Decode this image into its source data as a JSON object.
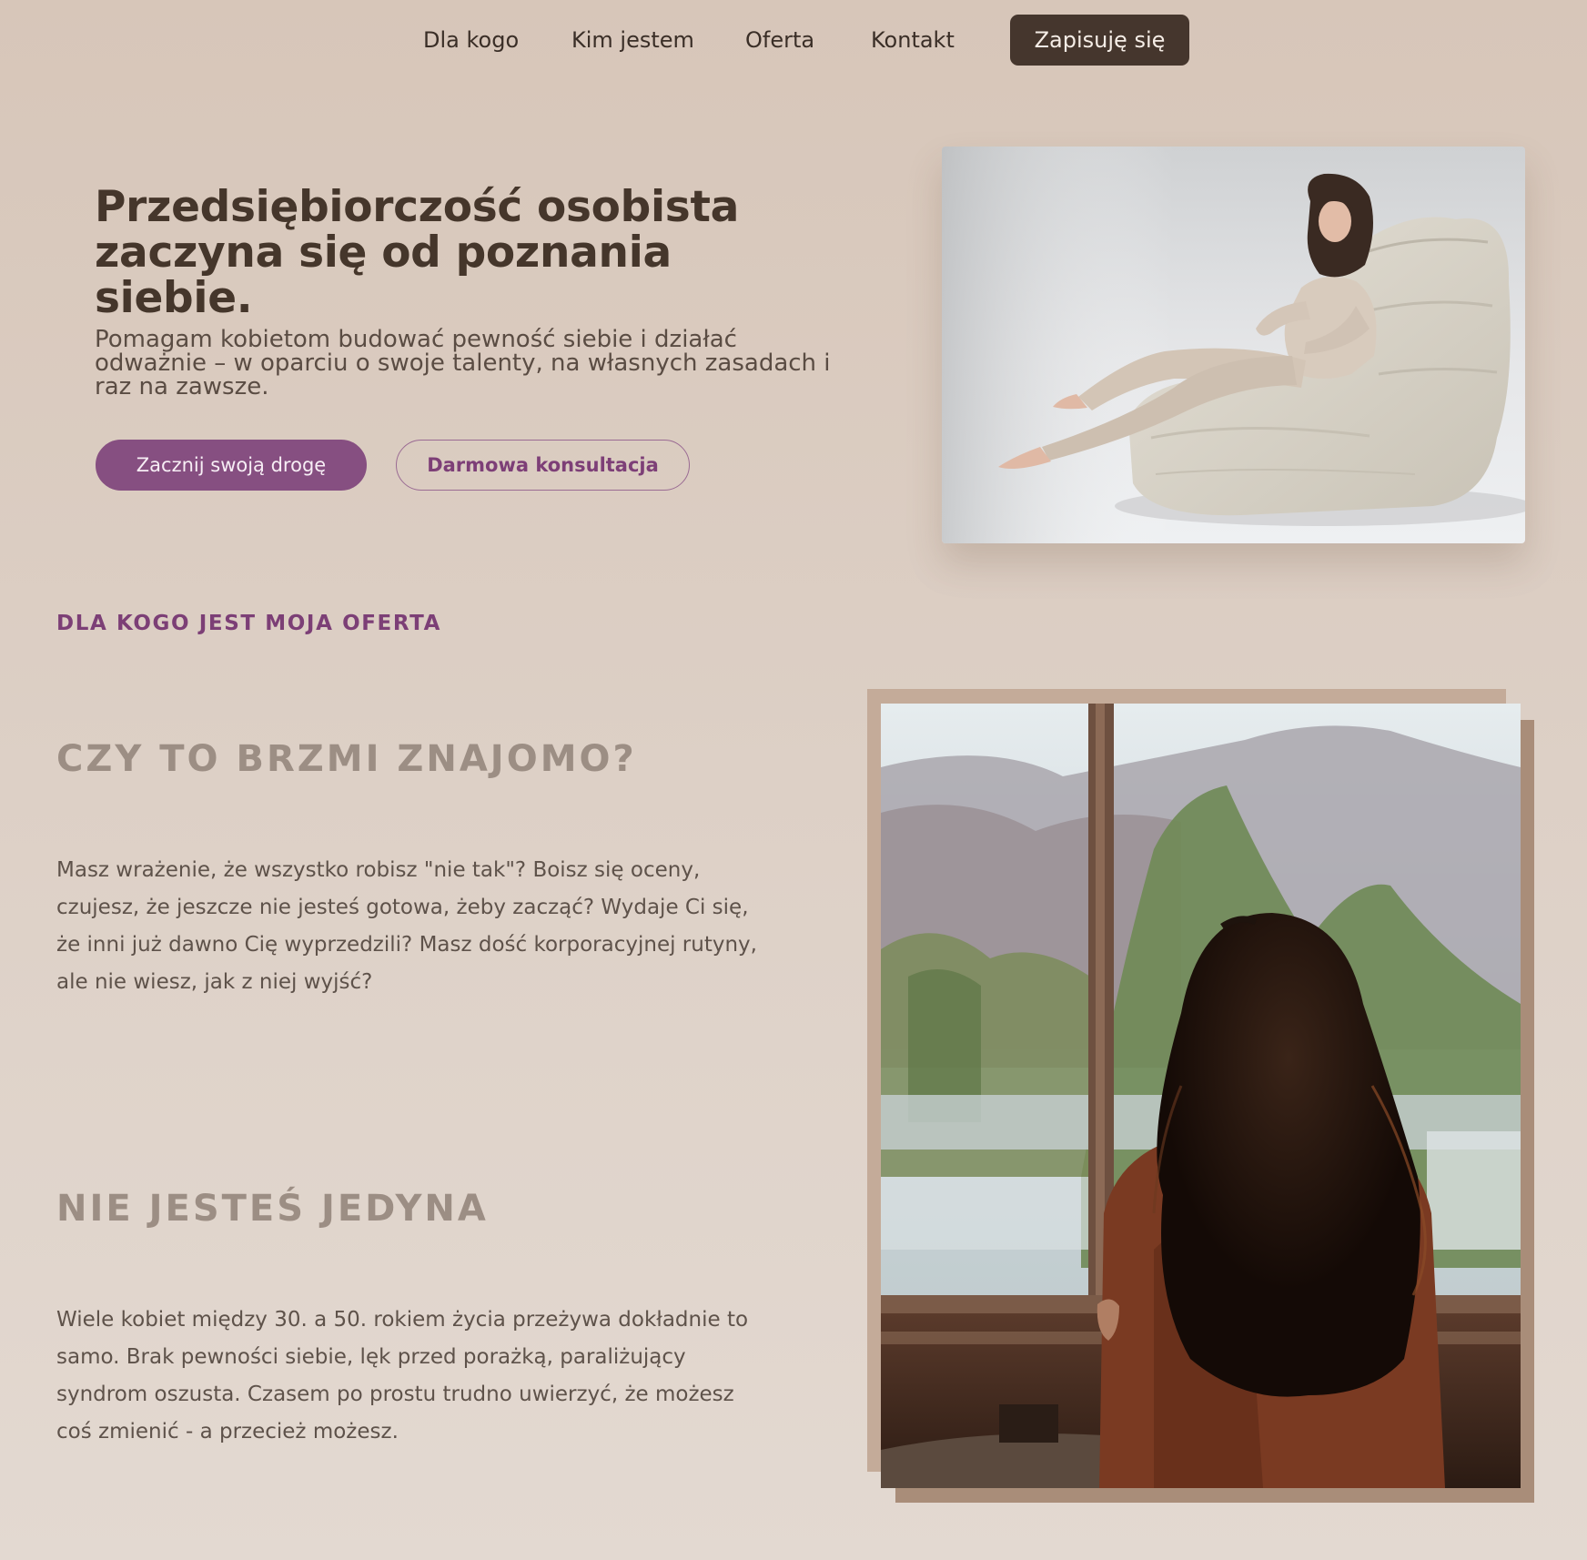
{
  "nav": {
    "items": [
      {
        "label": "Dla kogo"
      },
      {
        "label": "Kim jestem"
      },
      {
        "label": "Oferta"
      },
      {
        "label": "Kontakt"
      }
    ],
    "cta_label": "Zapisuję się"
  },
  "hero": {
    "title": "Przedsiębiorczość osobista zaczyna się od poznania siebie.",
    "subtitle": "Pomagam kobietom budować pewność siebie i działać odważnie – w oparciu o swoje talenty, na własnych zasadach i raz na zawsze.",
    "primary_button": "Zacznij swoją drogę",
    "secondary_button": "Darmowa konsultacja"
  },
  "section": {
    "eyebrow": "DLA KOGO JEST MOJA OFERTA",
    "blocks": [
      {
        "heading": "CZY TO BRZMI ZNAJOMO?",
        "text": "Masz wrażenie, że wszystko robisz \"nie tak\"? Boisz się oceny, czujesz, że jeszcze nie jesteś gotowa, żeby zacząć? Wydaje Ci się, że inni już dawno Cię wyprzedzili? Masz dość korporacyjnej rutyny, ale nie wiesz, jak z niej wyjść?"
      },
      {
        "heading": "NIE JESTEŚ JEDYNA",
        "text": "Wiele kobiet między 30. a 50. rokiem życia przeżywa dokładnie to samo. Brak pewności siebie, lęk przed porażką, paraliżujący syndrom oszusta. Czasem po prostu trudno uwierzyć, że możesz coś zmienić - a przecież możesz."
      }
    ]
  },
  "colors": {
    "background": "#d9c9bc",
    "brand_dark": "#45362d",
    "accent_plum": "#864f81",
    "heading_muted": "#9c8e84"
  }
}
